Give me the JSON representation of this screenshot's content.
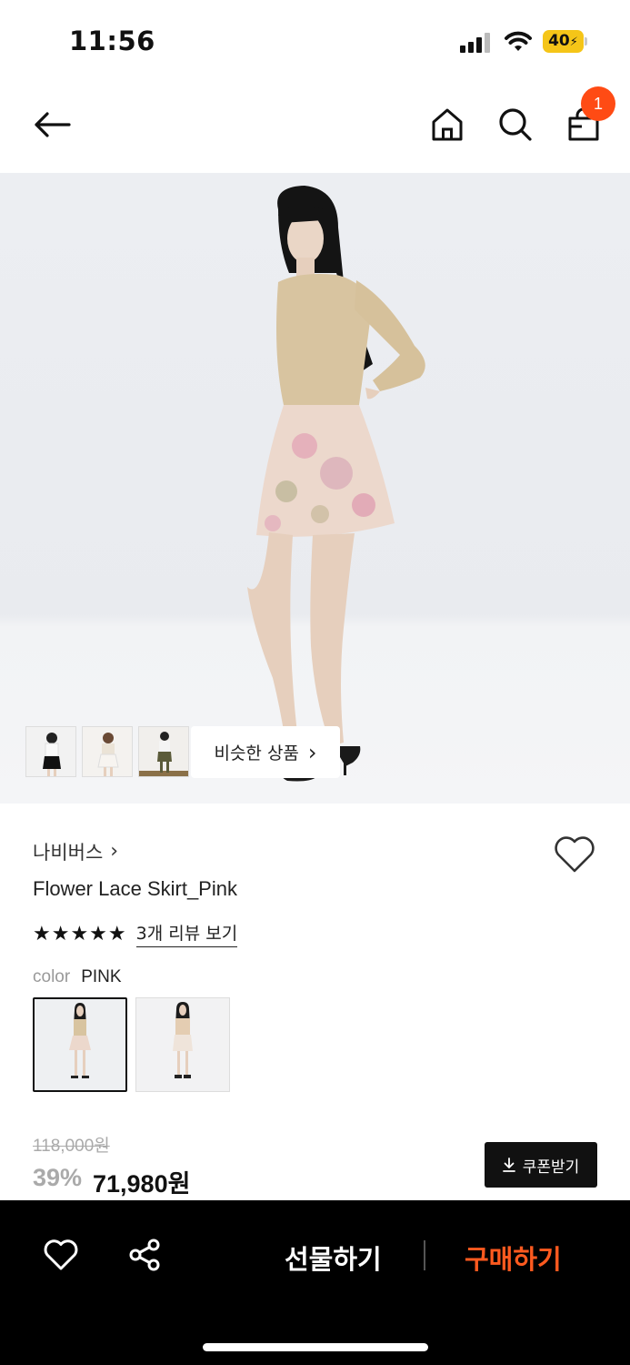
{
  "status_bar": {
    "time": "11:56",
    "battery": "40"
  },
  "nav": {
    "cart_count": "1"
  },
  "hero": {
    "similar_label": "비슷한 상품",
    "similar_chevron": "›"
  },
  "product": {
    "brand": "나비버스",
    "brand_chevron": "›",
    "name": "Flower Lace Skirt_Pink",
    "stars": "★★★★★",
    "review_link": "3개 리뷰 보기",
    "color_label": "color",
    "color_value": "PINK"
  },
  "price": {
    "original": "118,000원",
    "discount": "39%",
    "final": "71,980원",
    "coupon_label": "쿠폰받기"
  },
  "bottom_bar": {
    "gift_label": "선물하기",
    "buy_label": "구매하기"
  },
  "colors": {
    "accent": "#ff4b14",
    "buy": "#ff5a1f",
    "bar": "#000000"
  },
  "icons": [
    "back-arrow-icon",
    "home-icon",
    "search-icon",
    "shopping-bag-icon",
    "heart-icon",
    "share-icon",
    "download-icon"
  ]
}
